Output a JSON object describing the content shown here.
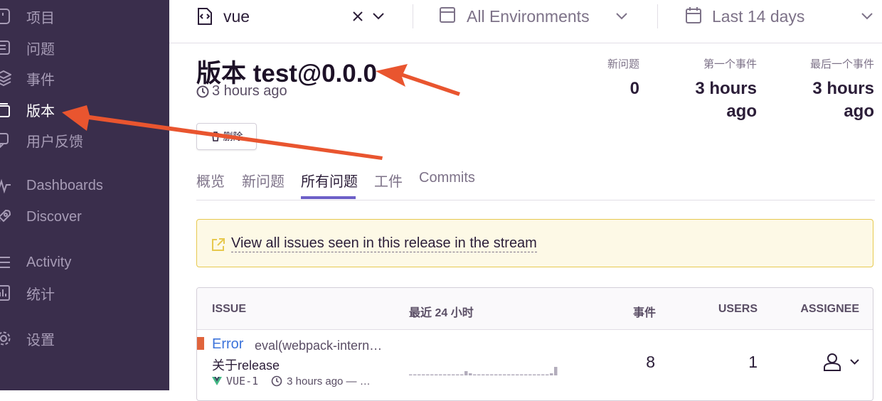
{
  "sidebar": {
    "items": [
      {
        "label": "项目",
        "icon": "project-icon"
      },
      {
        "label": "问题",
        "icon": "issues-icon"
      },
      {
        "label": "事件",
        "icon": "events-icon"
      },
      {
        "label": "版本",
        "icon": "releases-icon",
        "active": true
      },
      {
        "label": "用户反馈",
        "icon": "feedback-icon"
      },
      {
        "label": "Dashboards",
        "icon": "dashboards-icon"
      },
      {
        "label": "Discover",
        "icon": "discover-icon"
      },
      {
        "label": "Activity",
        "icon": "activity-icon"
      },
      {
        "label": "统计",
        "icon": "stats-icon"
      },
      {
        "label": "设置",
        "icon": "settings-icon"
      }
    ]
  },
  "topbar": {
    "project": "vue",
    "environment": "All Environments",
    "time_range": "Last 14 days"
  },
  "release": {
    "title": "版本 test@0.0.0",
    "age": "3 hours ago",
    "stats": [
      {
        "label": "新问题",
        "value": "0"
      },
      {
        "label": "第一个事件",
        "value_line1": "3 hours",
        "value_line2": "ago"
      },
      {
        "label": "最后一个事件",
        "value_line1": "3 hours",
        "value_line2": "ago"
      }
    ],
    "delete_label": "删除"
  },
  "tabs": [
    "概览",
    "新问题",
    "所有问题",
    "工件",
    "Commits"
  ],
  "active_tab": "所有问题",
  "alert": {
    "text": "View all issues seen in this release in the stream"
  },
  "table": {
    "headers": [
      "ISSUE",
      "最近 24 小时",
      "事件",
      "USERS",
      "ASSIGNEE"
    ],
    "rows": [
      {
        "type": "Error",
        "message": "eval(webpack-internal:///",
        "culprit": "关于release",
        "short_id": "VUE-1",
        "time": "3 hours ago — …",
        "events": "8",
        "users": "1",
        "trend": [
          0,
          0,
          0,
          0,
          0,
          0,
          0,
          0,
          0,
          0,
          0,
          0,
          0,
          2,
          1,
          0,
          0,
          0,
          0,
          0,
          0,
          0,
          0,
          0,
          0,
          0,
          0,
          0,
          0,
          0,
          0,
          0,
          0,
          1,
          4
        ]
      }
    ]
  },
  "colors": {
    "sidebar": "#3a2e4c",
    "accent": "#6c5fc7",
    "link": "#3d74db",
    "error": "#e0643c",
    "arrow": "#e9552f"
  }
}
